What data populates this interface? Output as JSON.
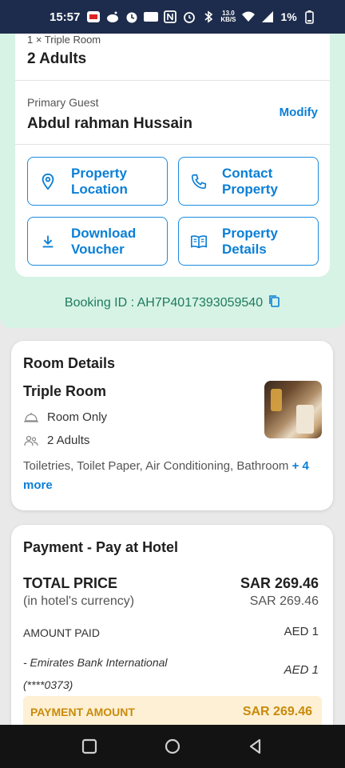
{
  "status_bar": {
    "time": "15:57",
    "net_speed_top": "13.0",
    "net_speed_bottom": "KB/S",
    "battery_percent": "1%"
  },
  "booking": {
    "room_line": "1 × Triple Room",
    "guests": "2 Adults",
    "primary_guest_label": "Primary Guest",
    "primary_guest_name": "Abdul rahman  Hussain",
    "modify_label": "Modify",
    "actions": [
      {
        "label_line1": "Property",
        "label_line2": "Location",
        "icon": "location-pin-icon"
      },
      {
        "label_line1": "Contact",
        "label_line2": "Property",
        "icon": "phone-icon"
      },
      {
        "label_line1": "Download",
        "label_line2": "Voucher",
        "icon": "download-icon"
      },
      {
        "label_line1": "Property",
        "label_line2": "Details",
        "icon": "book-icon"
      }
    ],
    "booking_id_text": "Booking ID : AH7P4017393059540"
  },
  "room_details": {
    "title": "Room Details",
    "room_name": "Triple Room",
    "meal_plan": "Room Only",
    "occupancy": "2 Adults",
    "amenities": "Toiletries, Toilet Paper, Air Conditioning, Bathroom",
    "more_link": "+ 4 more"
  },
  "payment": {
    "title": "Payment - Pay at Hotel",
    "total_label": "TOTAL PRICE",
    "total_value": "SAR 269.46",
    "currency_note": "(in hotel's currency)",
    "currency_value": "SAR 269.46",
    "amount_paid_label": "AMOUNT PAID",
    "amount_paid_value": "AED 1",
    "bank_line1": "- Emirates Bank International",
    "bank_line2": "(****0373)",
    "bank_value": "AED 1",
    "payment_amount_label": "PAYMENT AMOUNT",
    "payment_amount_value": "SAR 269.46"
  },
  "colors": {
    "status_bar": "#1d2c4c",
    "mint_background": "#d6f3e5",
    "accent_blue": "#0b7fd6",
    "booking_id_green": "#1e7a5e",
    "payment_amount_orange": "#c98a0b"
  }
}
